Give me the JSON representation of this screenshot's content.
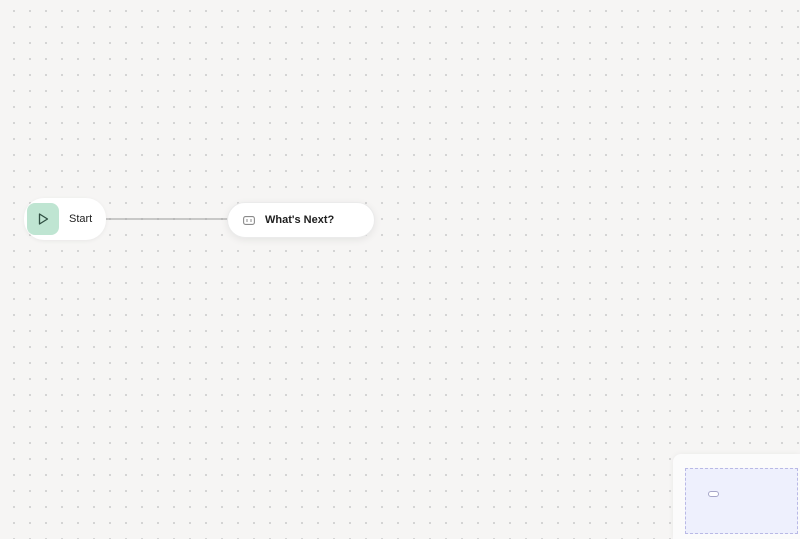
{
  "canvas": {
    "background_color": "#f6f5f4",
    "dot_color": "#cfcfcf"
  },
  "nodes": {
    "start": {
      "label": "Start",
      "icon": "play-icon",
      "icon_bg_color": "#bfe5d2",
      "icon_color": "#2f4f42"
    },
    "whats_next": {
      "label": "What's Next?",
      "icon": "input-box-icon",
      "icon_color": "#8a8a8a"
    }
  },
  "edge": {
    "from": "Start",
    "to": "What's Next?",
    "color": "#9a9a9a"
  },
  "minimap": {
    "viewport_color": "#eef0fd",
    "viewport_border_color": "#b9b9e6"
  }
}
